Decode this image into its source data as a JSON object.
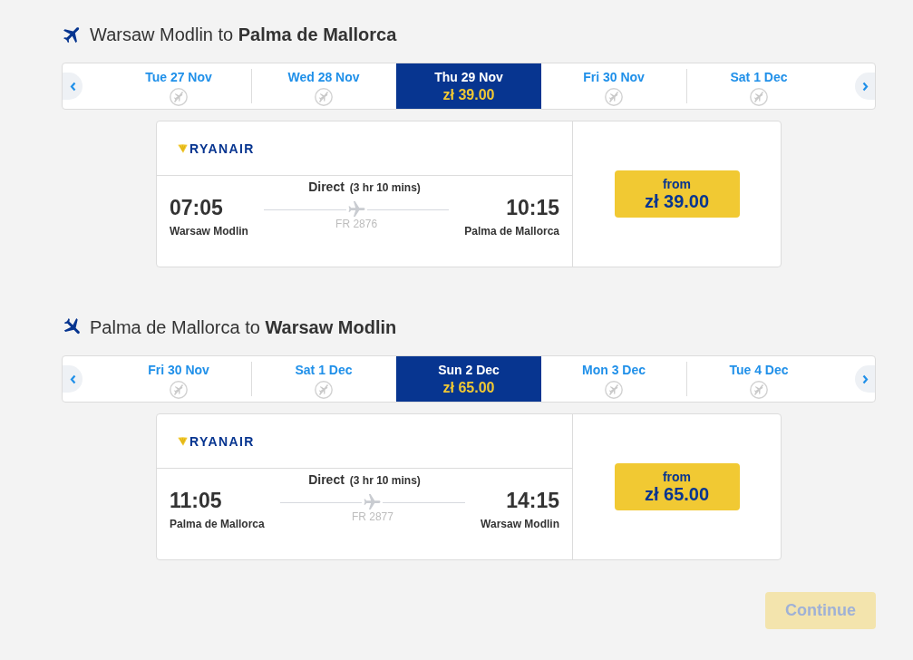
{
  "journeys": [
    {
      "kind": "outbound",
      "title": "Warsaw Modlin to **Palma de Mallorca**",
      "dates": [
        {
          "date": "Tue 27 Nov",
          "selected": false,
          "available": false
        },
        {
          "date": "Wed 28 Nov",
          "selected": false,
          "available": false
        },
        {
          "date": "Thu 29 Nov",
          "selected": true,
          "available": true,
          "price": "zł 39.00"
        },
        {
          "date": "Fri 30 Nov",
          "selected": false,
          "available": false
        },
        {
          "date": "Sat 1 Dec",
          "selected": false,
          "available": false
        }
      ],
      "flight": {
        "airline": "RYANAIR",
        "stops": "Direct",
        "duration": "(3 hr 10 mins)",
        "departure_time": "07:05",
        "arrival_time": "10:15",
        "flight_number": "FR 2876",
        "origin": "Warsaw Modlin",
        "destination": "Palma de Mallorca",
        "fare_label": "from",
        "fare_price": "zł 39.00"
      }
    },
    {
      "kind": "inbound",
      "title": "Palma de Mallorca to **Warsaw Modlin**",
      "dates": [
        {
          "date": "Fri 30 Nov",
          "selected": false,
          "available": false
        },
        {
          "date": "Sat 1 Dec",
          "selected": false,
          "available": false
        },
        {
          "date": "Sun 2 Dec",
          "selected": true,
          "available": true,
          "price": "zł 65.00"
        },
        {
          "date": "Mon 3 Dec",
          "selected": false,
          "available": false
        },
        {
          "date": "Tue 4 Dec",
          "selected": false,
          "available": false
        }
      ],
      "flight": {
        "airline": "RYANAIR",
        "stops": "Direct",
        "duration": "(3 hr 10 mins)",
        "departure_time": "11:05",
        "arrival_time": "14:15",
        "flight_number": "FR 2877",
        "origin": "Palma de Mallorca",
        "destination": "Warsaw Modlin",
        "fare_label": "from",
        "fare_price": "zł 65.00"
      }
    }
  ],
  "continue_button": {
    "label": "Continue",
    "disabled": true
  }
}
